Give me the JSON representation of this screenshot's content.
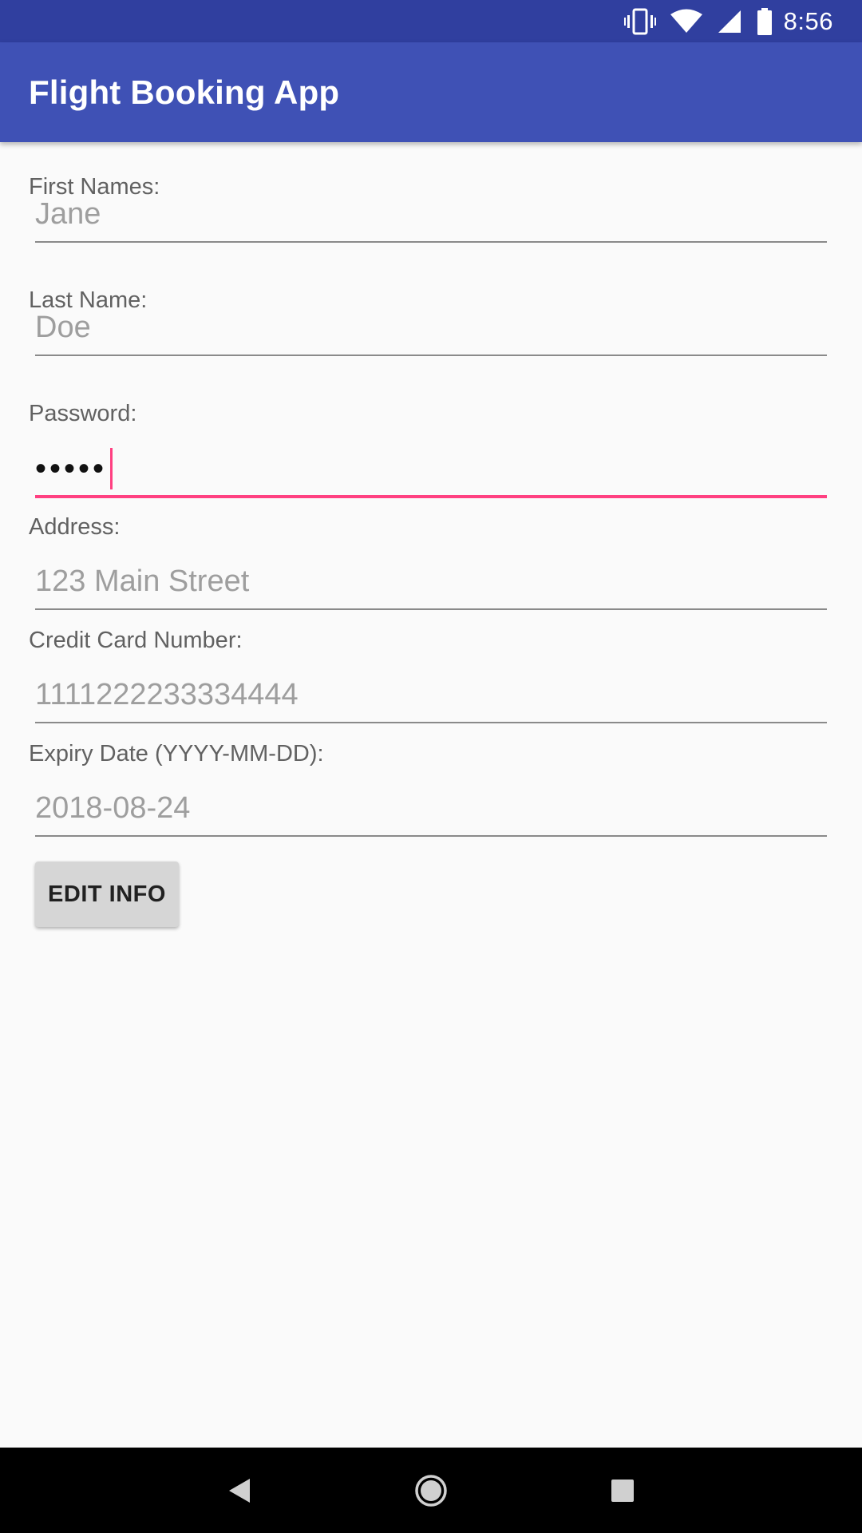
{
  "status_bar": {
    "time": "8:56",
    "icons": [
      "vibrate-icon",
      "wifi-icon",
      "signal-icon",
      "battery-icon"
    ]
  },
  "app_bar": {
    "title": "Flight Booking App"
  },
  "form": {
    "first_name": {
      "label": "First Names:",
      "value": "Jane"
    },
    "last_name": {
      "label": "Last Name:",
      "value": "Doe"
    },
    "password": {
      "label": "Password:",
      "value": "•••••"
    },
    "address": {
      "label": "Address:",
      "value": "123 Main Street"
    },
    "credit_card": {
      "label": "Credit Card Number:",
      "value": "1111222233334444"
    },
    "expiry": {
      "label": "Expiry Date (YYYY-MM-DD):",
      "value": "2018-08-24"
    }
  },
  "buttons": {
    "edit_label": "EDIT INFO"
  },
  "nav_bar": {
    "icons": [
      "back-icon",
      "home-icon",
      "recents-icon"
    ]
  },
  "colors": {
    "status_bar": "#303f9f",
    "app_bar": "#3f51b5",
    "accent": "#ff4081",
    "background": "#fafafa"
  }
}
